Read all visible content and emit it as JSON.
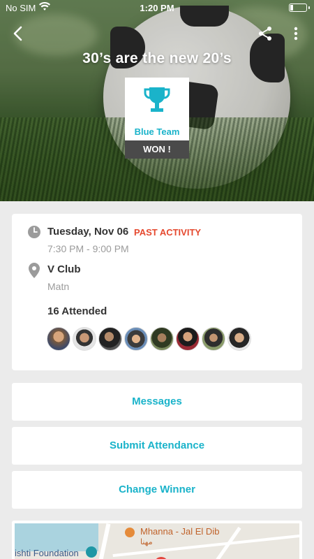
{
  "status_bar": {
    "carrier": "No SIM",
    "time": "1:20 PM"
  },
  "header": {
    "title": "30’s are the new 20’s"
  },
  "winner": {
    "team": "Blue Team",
    "result": "WON !"
  },
  "event": {
    "date": "Tuesday, Nov 06",
    "status": "PAST ACTIVITY",
    "time_range": "7:30 PM - 9:00 PM",
    "venue": "V Club",
    "venue_detail": "Matn",
    "attended": "16 Attended"
  },
  "actions": {
    "messages": "Messages",
    "submit_attendance": "Submit Attendance",
    "change_winner": "Change Winner"
  },
  "map": {
    "place1": "Mhanna - Jal El Dib",
    "place1_local": "مهنا",
    "place2": "ishti Foundation"
  },
  "colors": {
    "accent": "#1ab3ca",
    "past": "#e5492f",
    "won_bg": "#4a4a4a"
  }
}
